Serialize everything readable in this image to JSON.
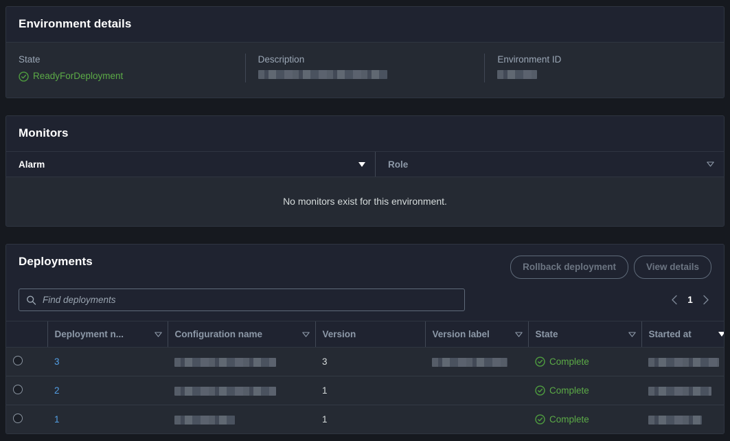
{
  "environment_details": {
    "title": "Environment details",
    "fields": [
      {
        "label": "State",
        "value": "ReadyForDeployment",
        "icon": "check-circle-icon",
        "redacted": false
      },
      {
        "label": "Description",
        "value": "",
        "redacted": true,
        "redact_width": 188
      },
      {
        "label": "Environment ID",
        "value": "",
        "redacted": true,
        "redact_width": 58
      }
    ]
  },
  "monitors": {
    "title": "Monitors",
    "columns": [
      {
        "label": "Alarm",
        "sort_icon": "triangle-solid-icon",
        "active": true
      },
      {
        "label": "Role",
        "sort_icon": "triangle-hollow-icon",
        "active": false
      }
    ],
    "empty_message": "No monitors exist for this environment."
  },
  "deployments": {
    "title": "Deployments",
    "buttons": [
      {
        "label": "Rollback deployment",
        "disabled": true
      },
      {
        "label": "View details",
        "disabled": true
      }
    ],
    "search": {
      "placeholder": "Find deployments",
      "value": "",
      "icon": "search-icon"
    },
    "pagination": {
      "prev_icon": "chevron-left-icon",
      "next_icon": "chevron-right-icon",
      "page": "1"
    },
    "columns": [
      {
        "label": "Deployment n...",
        "sort_icon": "triangle-hollow-icon",
        "active": false
      },
      {
        "label": "Configuration name",
        "sort_icon": "triangle-hollow-icon",
        "active": false
      },
      {
        "label": "Version",
        "sort_icon": "",
        "active": false
      },
      {
        "label": "Version label",
        "sort_icon": "triangle-hollow-icon",
        "active": false
      },
      {
        "label": "State",
        "sort_icon": "triangle-hollow-icon",
        "active": false
      },
      {
        "label": "Started at",
        "sort_icon": "triangle-solid-icon",
        "active": true
      }
    ],
    "rows": [
      {
        "selected": false,
        "deployment_number": "3",
        "configuration_name": "",
        "configuration_name_redacted": true,
        "configuration_redact_width": 148,
        "version": "3",
        "version_label": "",
        "version_label_redacted": true,
        "version_label_redact_width": 110,
        "state": "Complete",
        "state_icon": "check-circle-icon",
        "started_at": "",
        "started_at_redacted": true,
        "started_at_redact_width": 103
      },
      {
        "selected": false,
        "deployment_number": "2",
        "configuration_name": "",
        "configuration_name_redacted": true,
        "configuration_redact_width": 148,
        "version": "1",
        "version_label": "",
        "version_label_redacted": false,
        "version_label_redact_width": 0,
        "state": "Complete",
        "state_icon": "check-circle-icon",
        "started_at": "",
        "started_at_redacted": true,
        "started_at_redact_width": 92
      },
      {
        "selected": false,
        "deployment_number": "1",
        "configuration_name": "",
        "configuration_name_redacted": true,
        "configuration_redact_width": 88,
        "version": "1",
        "version_label": "",
        "version_label_redacted": false,
        "version_label_redact_width": 0,
        "state": "Complete",
        "state_icon": "check-circle-icon",
        "started_at": "",
        "started_at_redacted": true,
        "started_at_redact_width": 78
      }
    ]
  },
  "colors": {
    "page_bg": "#16191f",
    "panel_header_bg": "#1f2330",
    "panel_body_bg": "#252a33",
    "green": "#4f9e3f",
    "link": "#539fe5",
    "sorted_column_bg": "#2a3039"
  }
}
